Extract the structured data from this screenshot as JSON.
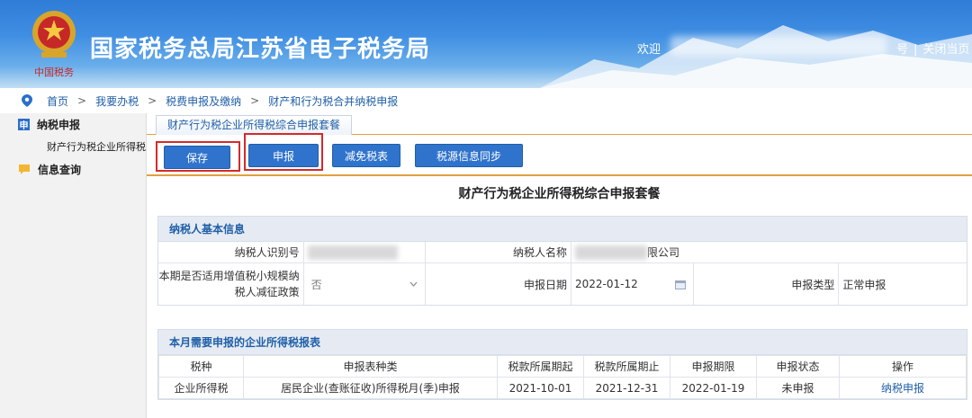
{
  "header": {
    "logo_caption": "中国税务",
    "title": "国家税务总局江苏省电子税务局",
    "welcome": "欢迎",
    "link_fragment": "号",
    "close_link": "关闭当页"
  },
  "breadcrumb": [
    "首页",
    "我要办税",
    "税费申报及缴纳",
    "财产和行为税合并纳税申报"
  ],
  "sidebar": {
    "group1": {
      "badge": "申",
      "label": "纳税申报"
    },
    "group1_item": "财产行为税企业所得税",
    "group2": {
      "label": "信息查询"
    }
  },
  "tab": {
    "label": "财产行为税企业所得税综合申报套餐"
  },
  "toolbar": {
    "save": "保存",
    "declare": "申报",
    "reduction": "减免税表",
    "sync": "税源信息同步"
  },
  "form_title": "财产行为税企业所得税综合申报套餐",
  "basic_info": {
    "header": "纳税人基本信息",
    "taxpayer_id_label": "纳税人识别号",
    "taxpayer_name_label": "纳税人名称",
    "taxpayer_name_suffix": "限公司",
    "policy_label_line1": "本期是否适用增值税小规模纳",
    "policy_label_line2": "税人减征政策",
    "policy_value": "否",
    "declare_date_label": "申报日期",
    "declare_date_value": "2022-01-12",
    "declare_type_label": "申报类型",
    "declare_type_value": "正常申报"
  },
  "monthly": {
    "header": "本月需要申报的企业所得税报表",
    "columns": [
      "税种",
      "申报表种类",
      "税款所属期起",
      "税款所属期止",
      "申报期限",
      "申报状态",
      "操作"
    ],
    "row": {
      "tax_type": "企业所得税",
      "form_type": "居民企业(查账征收)所得税月(季)申报",
      "period_start": "2021-10-01",
      "period_end": "2021-12-31",
      "deadline": "2022-01-19",
      "status": "未申报",
      "action": "纳税申报"
    }
  },
  "colors": {
    "accent": "#2f73cc",
    "highlight_box": "#d42a2a",
    "divider": "#e0a040"
  }
}
